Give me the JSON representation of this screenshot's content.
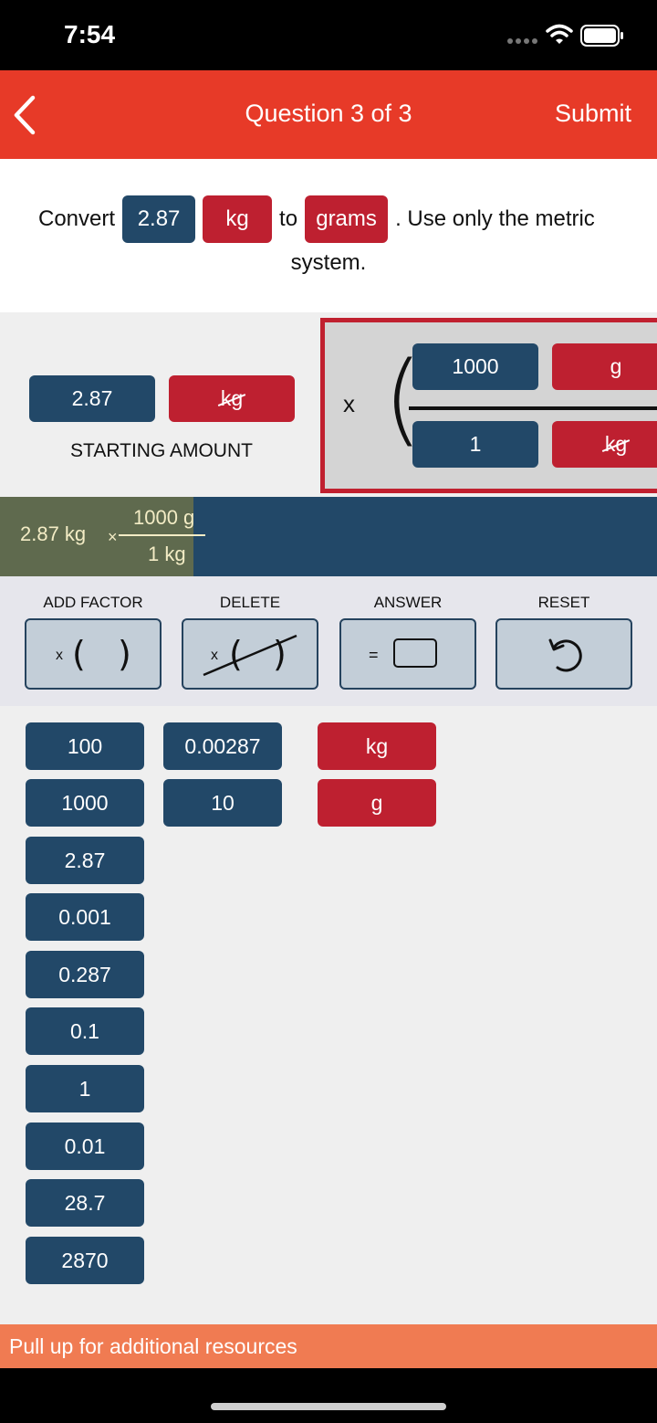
{
  "status_bar": {
    "time": "7:54"
  },
  "nav": {
    "title": "Question 3 of 3",
    "submit_label": "Submit"
  },
  "question": {
    "prefix": "Convert",
    "amount": "2.87",
    "from_unit": "kg",
    "to_word": "to",
    "to_unit": "grams",
    "suffix": ". Use only the metric",
    "line2": "system."
  },
  "setup": {
    "start_value": "2.87",
    "start_unit": "kg",
    "starting_label": "STARTING AMOUNT",
    "times": "x",
    "factor": {
      "numerator_value": "1000",
      "numerator_unit": "g",
      "denominator_value": "1",
      "denominator_unit": "kg"
    }
  },
  "equation": {
    "start": "2.87 kg",
    "times": "×",
    "numerator": "1000 g",
    "denominator": "1 kg"
  },
  "tools": [
    {
      "label": "ADD FACTOR",
      "icon": "add-factor-icon"
    },
    {
      "label": "DELETE",
      "icon": "delete-factor-icon"
    },
    {
      "label": "ANSWER",
      "icon": "answer-box-icon"
    },
    {
      "label": "RESET",
      "icon": "reset-icon"
    }
  ],
  "palette": {
    "values": [
      "100",
      "1000",
      "2.87",
      "0.001",
      "0.287",
      "0.1",
      "1",
      "0.01",
      "28.7",
      "2870",
      "0.00287",
      "10"
    ],
    "units": [
      "kg",
      "g"
    ]
  },
  "resources": {
    "label": "Pull up for additional resources"
  },
  "colors": {
    "accent": "#e73a28",
    "value_tile": "#224868",
    "unit_tile": "#be2030",
    "resources_bar": "#f07b52"
  }
}
